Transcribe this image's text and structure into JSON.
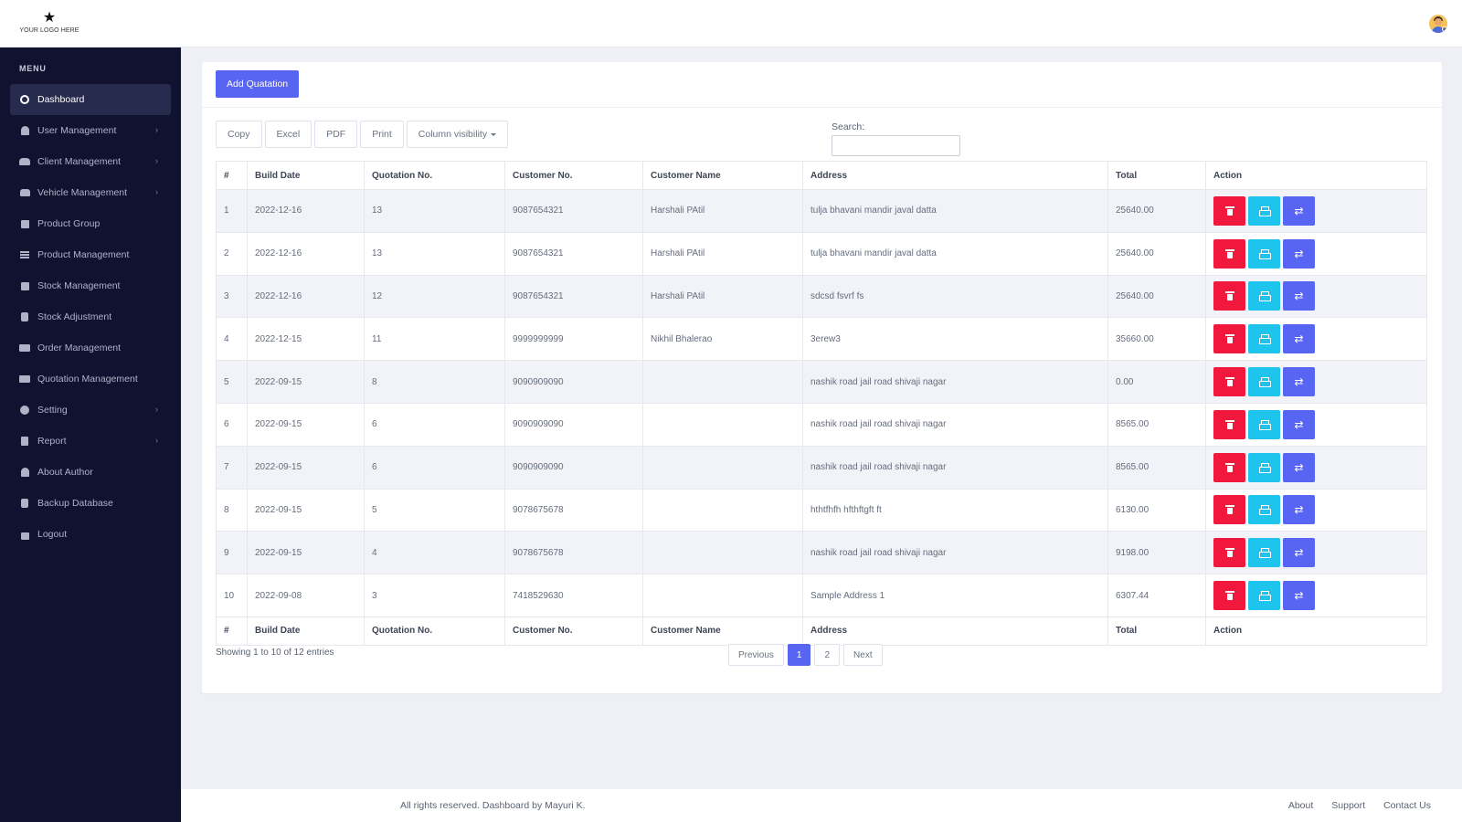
{
  "brand": {
    "logo_text": "YOUR LOGO HERE",
    "logo_icon": "star-icon"
  },
  "colors": {
    "sidebar_bg": "#10122f",
    "primary": "#5864f2",
    "danger": "#f0193d",
    "info": "#1ec4ec"
  },
  "sidebar": {
    "heading": "MENU",
    "items": [
      {
        "label": "Dashboard",
        "icon": "dashboard-icon",
        "active": true,
        "has_submenu": false
      },
      {
        "label": "User Management",
        "icon": "user-icon",
        "has_submenu": true
      },
      {
        "label": "Client Management",
        "icon": "users-icon",
        "has_submenu": true
      },
      {
        "label": "Vehicle Management",
        "icon": "car-icon",
        "has_submenu": true
      },
      {
        "label": "Product Group",
        "icon": "box-icon",
        "has_submenu": false
      },
      {
        "label": "Product Management",
        "icon": "list-icon",
        "has_submenu": false
      },
      {
        "label": "Stock Management",
        "icon": "box-icon",
        "has_submenu": false
      },
      {
        "label": "Stock Adjustment",
        "icon": "database-icon",
        "has_submenu": false
      },
      {
        "label": "Order Management",
        "icon": "card-icon",
        "has_submenu": false
      },
      {
        "label": "Quotation Management",
        "icon": "card-icon",
        "has_submenu": false
      },
      {
        "label": "Setting",
        "icon": "gear-icon",
        "has_submenu": true
      },
      {
        "label": "Report",
        "icon": "file-icon",
        "has_submenu": true
      },
      {
        "label": "About Author",
        "icon": "user-icon",
        "has_submenu": false
      },
      {
        "label": "Backup Database",
        "icon": "database-icon",
        "has_submenu": false
      },
      {
        "label": "Logout",
        "icon": "lock-icon",
        "has_submenu": false
      }
    ]
  },
  "toolbar": {
    "add_label": "Add Quatation",
    "buttons": [
      "Copy",
      "Excel",
      "PDF",
      "Print",
      "Column visibility"
    ],
    "search_label": "Search:",
    "search_value": ""
  },
  "table": {
    "columns": [
      "#",
      "Build Date",
      "Quotation No.",
      "Customer No.",
      "Customer Name",
      "Address",
      "Total",
      "Action"
    ],
    "rows": [
      [
        "1",
        "2022-12-16",
        "13",
        "9087654321",
        "Harshali PAtil",
        "tulja bhavani mandir javal datta",
        "25640.00"
      ],
      [
        "2",
        "2022-12-16",
        "13",
        "9087654321",
        "Harshali PAtil",
        "tulja bhavani mandir javal datta",
        "25640.00"
      ],
      [
        "3",
        "2022-12-16",
        "12",
        "9087654321",
        "Harshali PAtil",
        "sdcsd fsvrf fs",
        "25640.00"
      ],
      [
        "4",
        "2022-12-15",
        "11",
        "9999999999",
        "Nikhil Bhalerao",
        "3erew3",
        "35660.00"
      ],
      [
        "5",
        "2022-09-15",
        "8",
        "9090909090",
        "",
        "nashik road jail road shivaji nagar",
        "0.00"
      ],
      [
        "6",
        "2022-09-15",
        "6",
        "9090909090",
        "",
        "nashik road jail road shivaji nagar",
        "8565.00"
      ],
      [
        "7",
        "2022-09-15",
        "6",
        "9090909090",
        "",
        "nashik road jail road shivaji nagar",
        "8565.00"
      ],
      [
        "8",
        "2022-09-15",
        "5",
        "9078675678",
        "",
        "hthtfhfh hfthftgft ft",
        "6130.00"
      ],
      [
        "9",
        "2022-09-15",
        "4",
        "9078675678",
        "",
        "nashik road jail road shivaji nagar",
        "9198.00"
      ],
      [
        "10",
        "2022-09-08",
        "3",
        "7418529630",
        "",
        "Sample Address 1",
        "6307.44"
      ]
    ],
    "action_icons": [
      "trash-icon",
      "print-icon",
      "swap-icon"
    ]
  },
  "pagination": {
    "info": "Showing 1 to 10 of 12 entries",
    "previous": "Previous",
    "pages": [
      "1",
      "2"
    ],
    "current": "1",
    "next": "Next"
  },
  "footer": {
    "copyright": "All rights reserved. Dashboard by Mayuri K.",
    "links": [
      "About",
      "Support",
      "Contact Us"
    ]
  }
}
